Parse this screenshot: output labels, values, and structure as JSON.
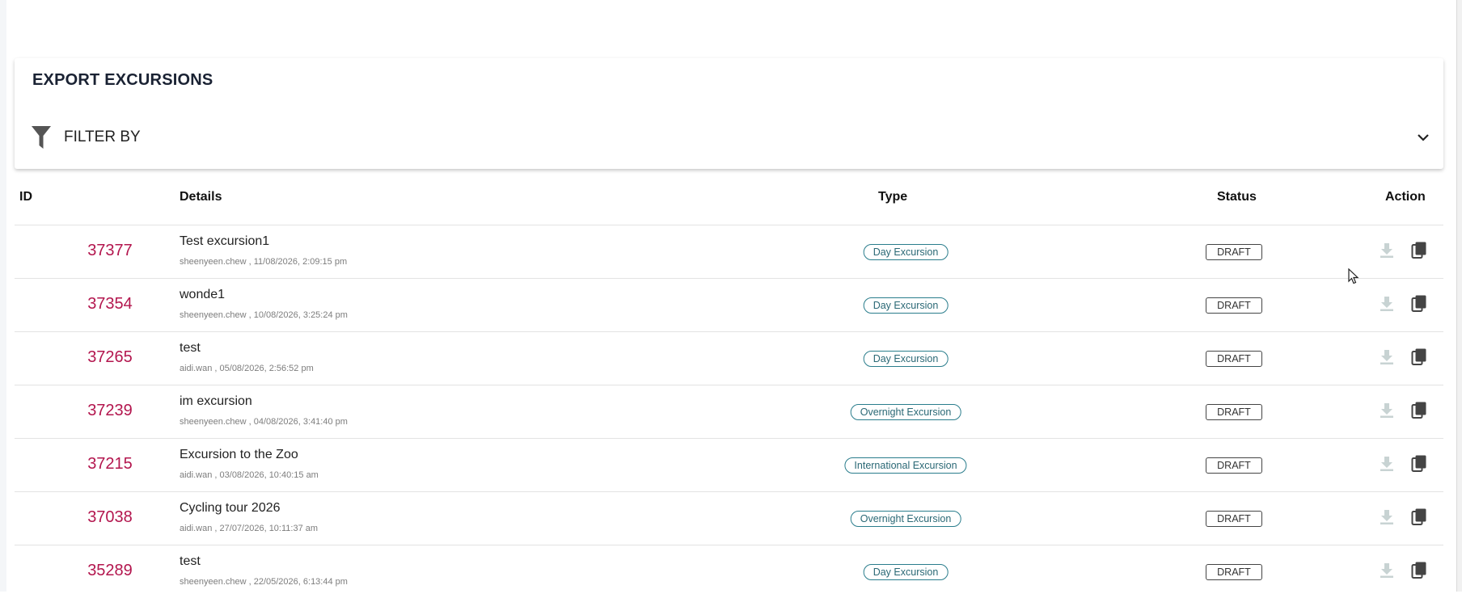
{
  "page": {
    "title": "EXPORT EXCURSIONS"
  },
  "filter": {
    "label": "FILTER BY",
    "icon": "filter-icon",
    "toggle_icon": "chevron-down-icon"
  },
  "table": {
    "headers": {
      "id": "ID",
      "details": "Details",
      "type": "Type",
      "status": "Status",
      "action": "Action"
    },
    "rows": [
      {
        "id": "37377",
        "title": "Test excursion1",
        "meta": "sheenyeen.chew , 11/08/2026, 2:09:15 pm",
        "type": "Day Excursion",
        "status": "DRAFT"
      },
      {
        "id": "37354",
        "title": "wonde1",
        "meta": "sheenyeen.chew , 10/08/2026, 3:25:24 pm",
        "type": "Day Excursion",
        "status": "DRAFT"
      },
      {
        "id": "37265",
        "title": "test",
        "meta": "aidi.wan , 05/08/2026, 2:56:52 pm",
        "type": "Day Excursion",
        "status": "DRAFT"
      },
      {
        "id": "37239",
        "title": "im excursion",
        "meta": "sheenyeen.chew , 04/08/2026, 3:41:40 pm",
        "type": "Overnight Excursion",
        "status": "DRAFT"
      },
      {
        "id": "37215",
        "title": "Excursion to the Zoo",
        "meta": "aidi.wan , 03/08/2026, 10:40:15 am",
        "type": "International Excursion",
        "status": "DRAFT"
      },
      {
        "id": "37038",
        "title": "Cycling tour 2026",
        "meta": "aidi.wan , 27/07/2026, 10:11:37 am",
        "type": "Overnight Excursion",
        "status": "DRAFT"
      },
      {
        "id": "35289",
        "title": "test",
        "meta": "sheenyeen.chew , 22/05/2026, 6:13:44 pm",
        "type": "Day Excursion",
        "status": "DRAFT"
      }
    ],
    "actions": {
      "download_icon": "download-icon",
      "copy_icon": "copy-icon"
    }
  },
  "colors": {
    "id_text": "#b3164e",
    "type_pill": "#2a7d8c",
    "title": "#1a2233",
    "download_disabled": "#c8d3d3",
    "copy_icon": "#444444"
  }
}
